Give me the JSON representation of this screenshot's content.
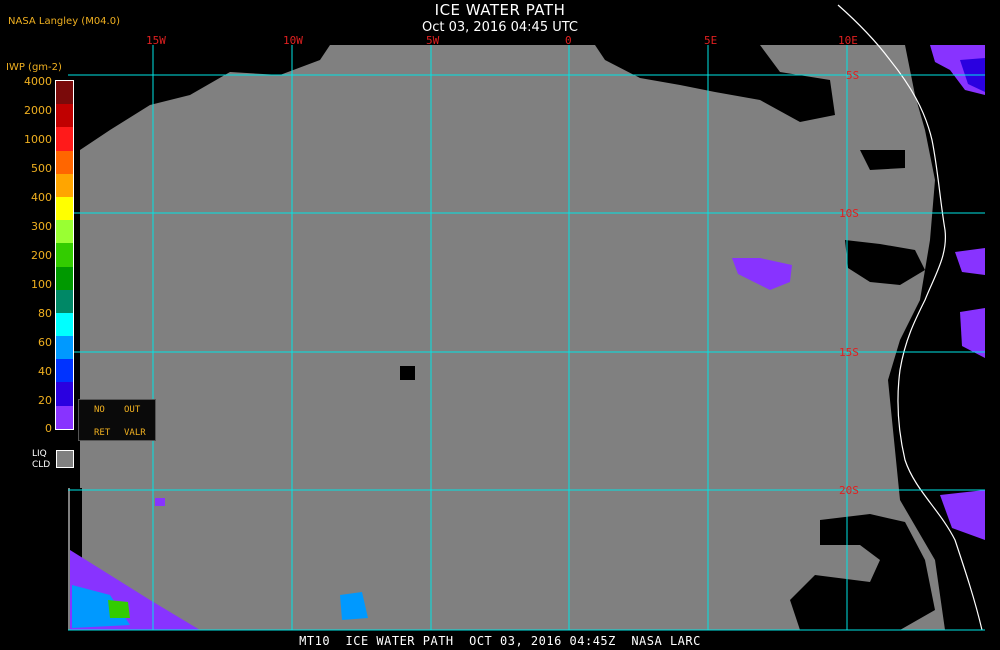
{
  "header": {
    "title": "ICE WATER PATH",
    "subtitle": "Oct 03, 2016 04:45 UTC",
    "agency": "NASA Langley (M04.0)"
  },
  "legend": {
    "title": "IWP (gm-2)",
    "ticks": [
      "4000",
      "2000",
      "1000",
      "500",
      "400",
      "300",
      "200",
      "100",
      "80",
      "60",
      "40",
      "20",
      "0"
    ],
    "colors": [
      "#7a0a0a",
      "#c00000",
      "#ff1a1a",
      "#ff6600",
      "#ffa500",
      "#ffff00",
      "#99ff33",
      "#33cc00",
      "#009900",
      "#008866",
      "#00ffff",
      "#0099ff",
      "#0033ff",
      "#2a00e0",
      "#8833ff"
    ],
    "no_ret": [
      "NO",
      "RET"
    ],
    "out_valr": [
      "OUT",
      "VALR"
    ],
    "liq": [
      "LIQ",
      "CLD"
    ],
    "liq_color": "#808080"
  },
  "map": {
    "top_labels": [
      "15W",
      "10W",
      "5W",
      "0",
      "5E",
      "10E"
    ],
    "side_labels": [
      "5S",
      "10S",
      "15S",
      "20S"
    ],
    "grid_color": "#00e5e5",
    "label_color": "#e02020",
    "land_color": "#000000",
    "liquid_cloud_color": "#808080",
    "coast_color": "#ffffff"
  },
  "footer": {
    "text": "MT10  ICE WATER PATH  OCT 03, 2016 04:45Z  NASA LARC"
  }
}
